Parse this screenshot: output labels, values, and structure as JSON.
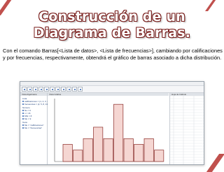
{
  "slide": {
    "title_line1": "Construcción de un",
    "title_line2": "Diagrama de Barras.",
    "description": "Con el comando Barras[<Lista de datos>, <Lista de frecuencias>], cambiando por calificaciones y por frecuencias, respectivamente, obtendrá el gráfico de barras asociado a dicha distribución.",
    "accent_color": "#c0504d"
  },
  "app": {
    "algebra_header": "Vista Algebraica",
    "graphics_header": "Vista Gráfica",
    "sheet_header": "Hoja de Cálculo",
    "algebra_items": [
      "Lista",
      "calificaciones = {1, 2, 3, 4, 5",
      "frecuencias = {2, 5, 8, 13, 4",
      "Número",
      "Nu = 0",
      "n = 16",
      "MSi = 8",
      "Mo = 9",
      "Texto",
      "Me = \"calificaciones\"",
      "Mo = \"frecuencias\""
    ]
  },
  "chart_data": {
    "type": "bar",
    "values": [
      3,
      2,
      4,
      6,
      4,
      10,
      4,
      3,
      4,
      2
    ],
    "ylim": [
      0,
      11
    ],
    "bar_fill": "#f5d6d2",
    "bar_stroke": "#8a2a26",
    "grid": false
  }
}
